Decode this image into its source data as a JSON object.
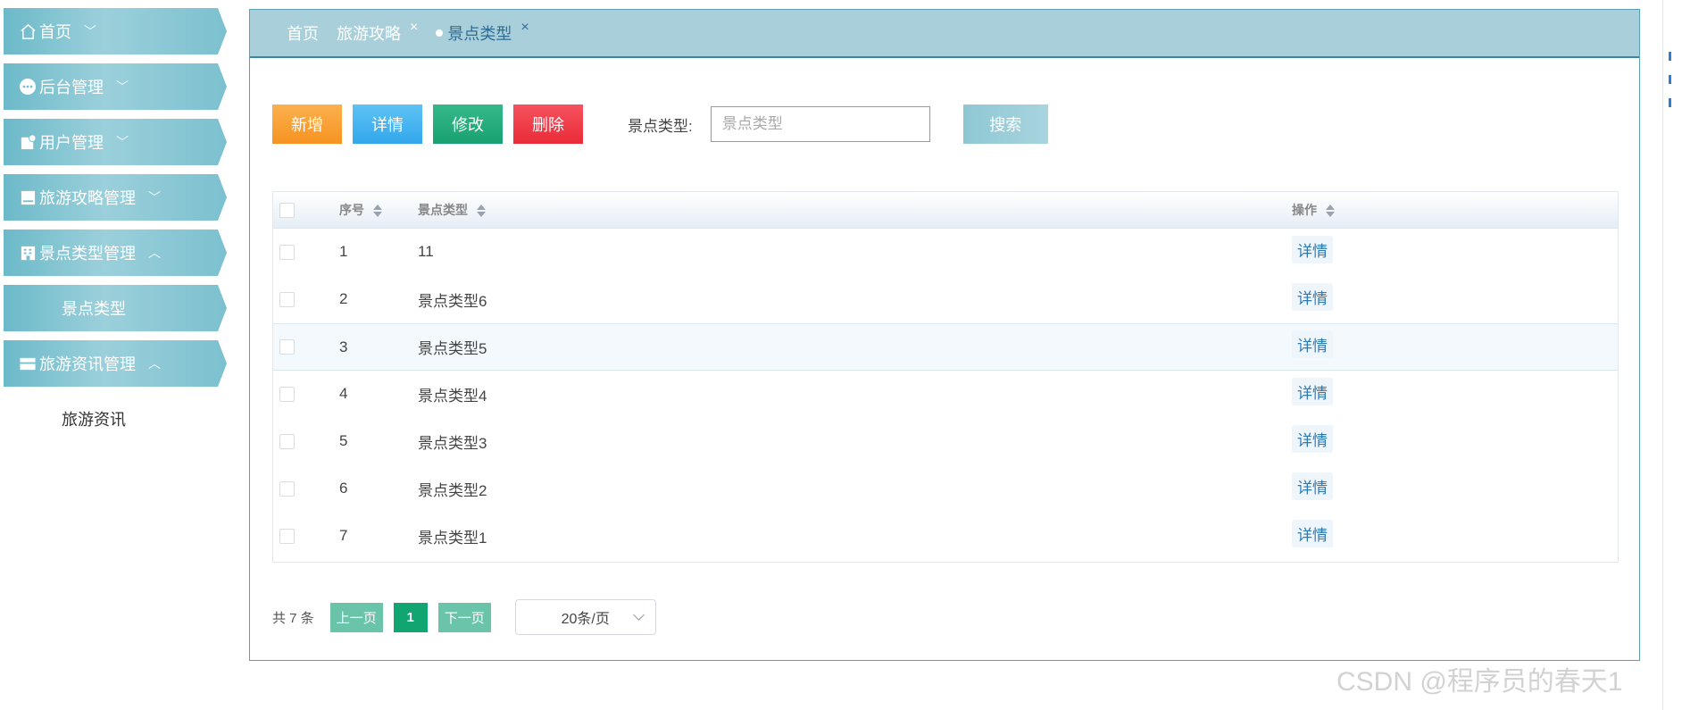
{
  "sidebar": {
    "items": [
      {
        "label": "首页",
        "icon": "home-icon",
        "expanded": false
      },
      {
        "label": "后台管理",
        "icon": "more-icon",
        "expanded": false
      },
      {
        "label": "用户管理",
        "icon": "user-doc-icon",
        "expanded": false
      },
      {
        "label": "旅游攻略管理",
        "icon": "monitor-icon",
        "expanded": false
      },
      {
        "label": "景点类型管理",
        "icon": "building-icon",
        "expanded": true
      },
      {
        "label": "旅游资讯管理",
        "icon": "card-icon",
        "expanded": true
      }
    ],
    "sub_scenic_type": "景点类型",
    "sub_travel_news": "旅游资讯"
  },
  "tabs": [
    {
      "label": "首页"
    },
    {
      "label": "旅游攻略"
    },
    {
      "label": "景点类型"
    }
  ],
  "tab_close": "×",
  "toolbar": {
    "add_label": "新增",
    "detail_label": "详情",
    "edit_label": "修改",
    "delete_label": "删除",
    "search_label": "景点类型:",
    "search_placeholder": "景点类型",
    "search_button": "搜索"
  },
  "table": {
    "headers": {
      "index": "序号",
      "type": "景点类型",
      "action": "操作"
    },
    "action_label": "详情",
    "rows": [
      {
        "index": "1",
        "type": "11"
      },
      {
        "index": "2",
        "type": "景点类型6"
      },
      {
        "index": "3",
        "type": "景点类型5"
      },
      {
        "index": "4",
        "type": "景点类型4"
      },
      {
        "index": "5",
        "type": "景点类型3"
      },
      {
        "index": "6",
        "type": "景点类型2"
      },
      {
        "index": "7",
        "type": "景点类型1"
      }
    ]
  },
  "pager": {
    "total": "共 7 条",
    "prev": "上一页",
    "current": "1",
    "next": "下一页",
    "page_size": "20条/页"
  },
  "watermark": "CSDN @程序员的春天1",
  "colors": {
    "accent": "#3d86a8",
    "add": "#f69322",
    "detail": "#32a7ea",
    "edit": "#19a172",
    "delete": "#ea2b38",
    "page_current": "#11a571"
  }
}
